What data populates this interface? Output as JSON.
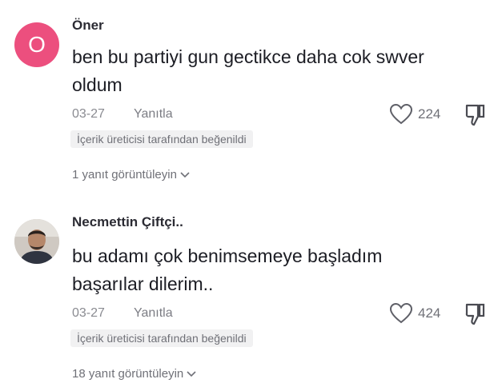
{
  "comments": [
    {
      "avatar_letter": "O",
      "avatar_color": "#ec4f7e",
      "username": "Öner",
      "text_line1": "ben bu partiyi gun gectikce daha cok swver",
      "text_line2": "oldum",
      "date": "03-27",
      "reply_label": "Yanıtla",
      "likes": "224",
      "creator_badge": "İçerik üreticisi tarafından beğenildi",
      "view_replies": "1 yanıt görüntüleyin"
    },
    {
      "username": "Necmettin Çiftçi..",
      "text_line1": "bu adamı çok benimsemeye başladım",
      "text_line2": "başarılar dilerim..",
      "date": "03-27",
      "reply_label": "Yanıtla",
      "likes": "424",
      "creator_badge": "İçerik üreticisi tarafından beğenildi",
      "view_replies": "18 yanıt görüntüleyin"
    }
  ],
  "icons": {
    "like": "heart-outline-icon",
    "dislike": "thumbs-down-icon",
    "expand": "chevron-down-icon"
  }
}
